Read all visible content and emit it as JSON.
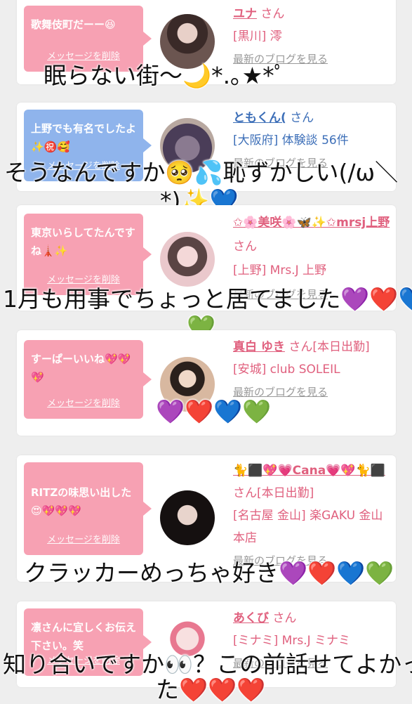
{
  "colors": {
    "pink_bubble": "#f7a1b3",
    "blue_bubble": "#8fb4ec",
    "pink_text": "#e0607e",
    "blue_text": "#3d6fb8"
  },
  "ui": {
    "delete_label": "メッセージを削除",
    "blog_label": "最新のブログを見る"
  },
  "messages": [
    {
      "bubble": "歌舞伎町だーー😆",
      "name": "ユナ",
      "san": "さん",
      "area": "[黒川] 澪",
      "theme": "pink"
    },
    {
      "bubble": "上野でも有名でしたよ✨㊗️🥰",
      "name": "ともくん(",
      "san": "さん",
      "area": "[大阪府] 体験談 56件",
      "theme": "blue"
    },
    {
      "bubble": "東京いらしてたんですね🗼✨",
      "name": "✩🌸美咲🌸🦋✨✩mrsj上野",
      "san": "さん",
      "area": "[上野] Mrs.J 上野",
      "theme": "pink"
    },
    {
      "bubble": "すーぱーいいね💖💖💖",
      "name": "真白 ゆき",
      "san": "さん[本日出勤]",
      "area": "[安城] club SOLEIL",
      "theme": "pink"
    },
    {
      "bubble": "RITZの味思い出した😍💖💖💖",
      "name": "🐈⬛💖💗Cana💗💖🐈⬛",
      "san": "さん[本日出勤]",
      "area": "[名古屋 金山] 楽GAKU 金山本店",
      "theme": "pink"
    },
    {
      "bubble": "凛さんに宜しくお伝え下さい。笑",
      "name": "あくび",
      "san": "さん",
      "area": "[ミナミ] Mrs.J ミナミ",
      "theme": "pink"
    }
  ],
  "comments": {
    "c1": "眠らない街〜🌙*.｡★*ﾟ",
    "c2a": "そうなんですか🥺💦恥ずかしい(/ω＼",
    "c2b": "*)✨💙",
    "c3a": "1月も用事でちょっと居てました💜❤️💙",
    "c3b": "💚",
    "c4": "💜❤️💙💚",
    "c5": "クラッカーめっちゃ好き💜❤️💙💚",
    "c6a": "知り合いですか👀？この前話せてよかっ",
    "c6b": "た❤️❤️❤️"
  }
}
